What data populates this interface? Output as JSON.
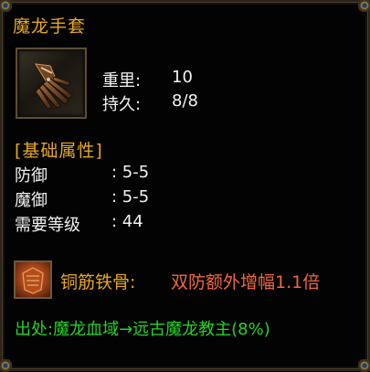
{
  "item": {
    "name": "魔龙手套",
    "icon": "gauntlet-icon"
  },
  "basic": {
    "weight_label": "重里:",
    "weight_value": "10",
    "durability_label": "持久:",
    "durability_value": "8/8"
  },
  "attributes": {
    "header": "[基础属性]",
    "rows": [
      {
        "label": "防御",
        "value": ": 5-5"
      },
      {
        "label": "魔御",
        "value": ": 5-5"
      },
      {
        "label": "需要等级",
        "value": ": 44"
      }
    ]
  },
  "skill": {
    "icon": "skill-icon",
    "name": "铜筋铁骨:",
    "description": "双防额外增幅1.1倍"
  },
  "source": {
    "text": "出处:魔龙血域→远古魔龙教主(8%)"
  },
  "colors": {
    "title": "#e8a820",
    "text": "#f2f2f2",
    "skill_desc": "#f06840",
    "source": "#22d622"
  }
}
